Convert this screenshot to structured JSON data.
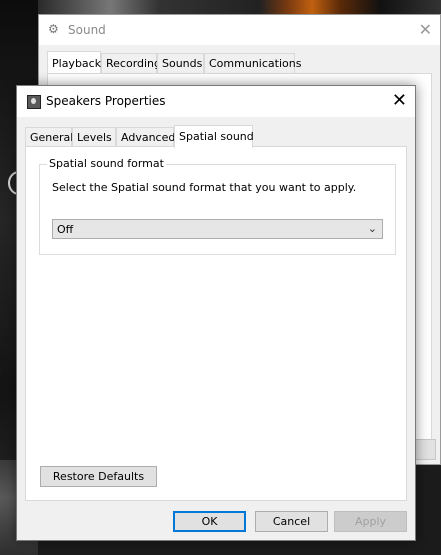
{
  "background_window": {
    "title": "Sound",
    "tabs": [
      "Playback",
      "Recording",
      "Sounds",
      "Communications"
    ],
    "active_tab": "Playback"
  },
  "dialog": {
    "title": "Speakers Properties",
    "tabs": [
      "General",
      "Levels",
      "Advanced",
      "Spatial sound"
    ],
    "active_tab": "Spatial sound",
    "group_title": "Spatial sound format",
    "group_description": "Select the Spatial sound format that you want to apply.",
    "format_value": "Off",
    "restore_label": "Restore Defaults",
    "ok_label": "OK",
    "cancel_label": "Cancel",
    "apply_label": "Apply"
  },
  "colors": {
    "focus_border": "#0078d7",
    "dialog_bg": "#f0f0f0"
  }
}
